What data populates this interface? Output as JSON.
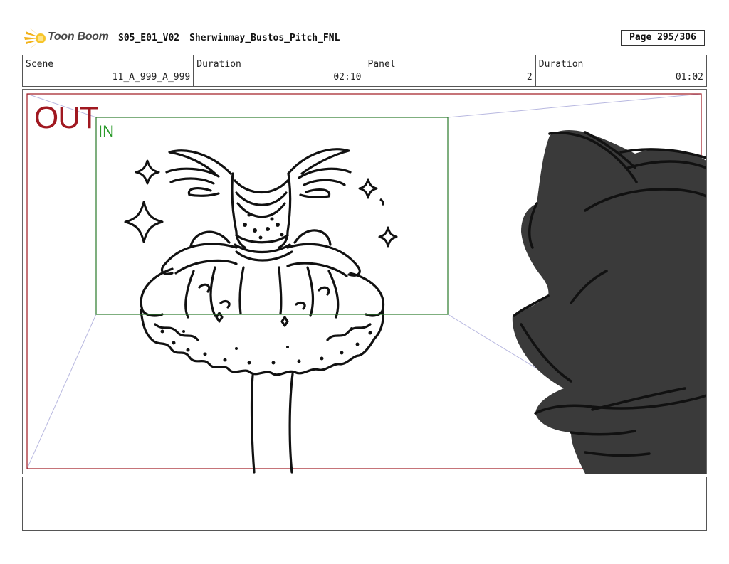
{
  "header": {
    "logo_text": "Toon Boom",
    "episode": "S05_E01_V02",
    "file_name": "Sherwinmay_Bustos_Pitch_FNL",
    "page": "Page 295/306"
  },
  "info": {
    "scene_label": "Scene",
    "scene_value": "11_A_999_A_999",
    "scene_duration_label": "Duration",
    "scene_duration_value": "02:10",
    "panel_label": "Panel",
    "panel_value": "2",
    "panel_duration_label": "Duration",
    "panel_duration_value": "01:02"
  },
  "panel": {
    "out_label": "OUT",
    "in_label": "IN",
    "colors": {
      "out_frame": "#a01820",
      "in_frame": "#2a7a2a",
      "camera_lines": "#b8b8e0",
      "character_fill": "#3a3a3a"
    },
    "icons": [
      "sparkle-icon",
      "toon-boom-logo-icon"
    ]
  },
  "notes": {
    "text": ""
  }
}
